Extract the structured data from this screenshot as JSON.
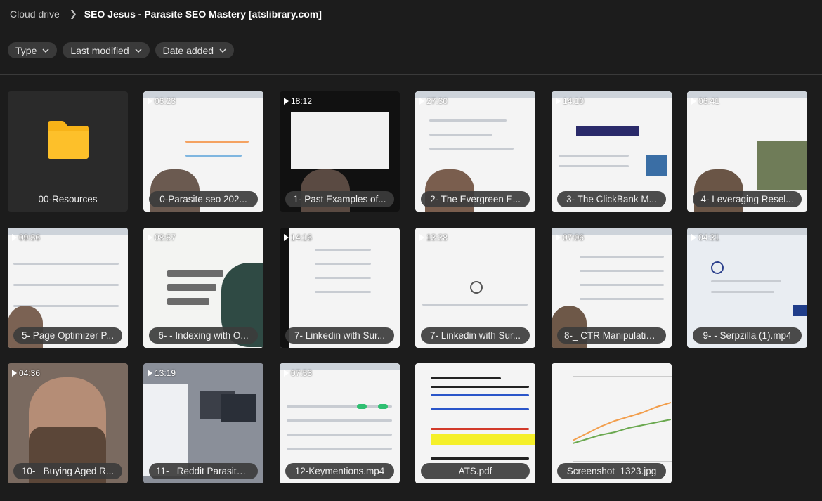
{
  "breadcrumb": {
    "root": "Cloud drive",
    "current": "SEO Jesus - Parasite SEO Mastery [atslibrary.com]"
  },
  "filters": [
    "Type",
    "Last modified",
    "Date added"
  ],
  "items": [
    {
      "name": "00-Resources",
      "type": "folder"
    },
    {
      "name": "0-Parasite seo 202...",
      "duration": "06:23",
      "type": "video"
    },
    {
      "name": "1- Past Examples of...",
      "duration": "18:12",
      "type": "video"
    },
    {
      "name": "2- The Evergreen E...",
      "duration": "27:30",
      "type": "video"
    },
    {
      "name": "3- The ClickBank M...",
      "duration": "14:10",
      "type": "video"
    },
    {
      "name": "4- Leveraging Resel...",
      "duration": "06:41",
      "type": "video"
    },
    {
      "name": "5- Page Optimizer P...",
      "duration": "09:56",
      "type": "video"
    },
    {
      "name": "6- - Indexing with O...",
      "duration": "08:57",
      "type": "video"
    },
    {
      "name": "7- Linkedin with Sur...",
      "duration": "14:16",
      "type": "video"
    },
    {
      "name": "7- Linkedin with Sur...",
      "duration": "13:38",
      "type": "video"
    },
    {
      "name": "8-_ CTR Manipulatio...",
      "duration": "07:06",
      "type": "video"
    },
    {
      "name": "9- - Serpzilla (1).mp4",
      "duration": "04:31",
      "type": "video"
    },
    {
      "name": "10-_ Buying Aged R...",
      "duration": "04:36",
      "type": "video"
    },
    {
      "name": "11-_ Reddit Parasite ...",
      "duration": "13:19",
      "type": "video"
    },
    {
      "name": "12-Keymentions.mp4",
      "duration": "07:53",
      "type": "video"
    },
    {
      "name": "ATS.pdf",
      "type": "pdf"
    },
    {
      "name": "Screenshot_1323.jpg",
      "type": "image"
    }
  ],
  "colors": {
    "background": "#1c1c1c",
    "chip": "#3a3a3a",
    "folder": "#f7b318"
  }
}
